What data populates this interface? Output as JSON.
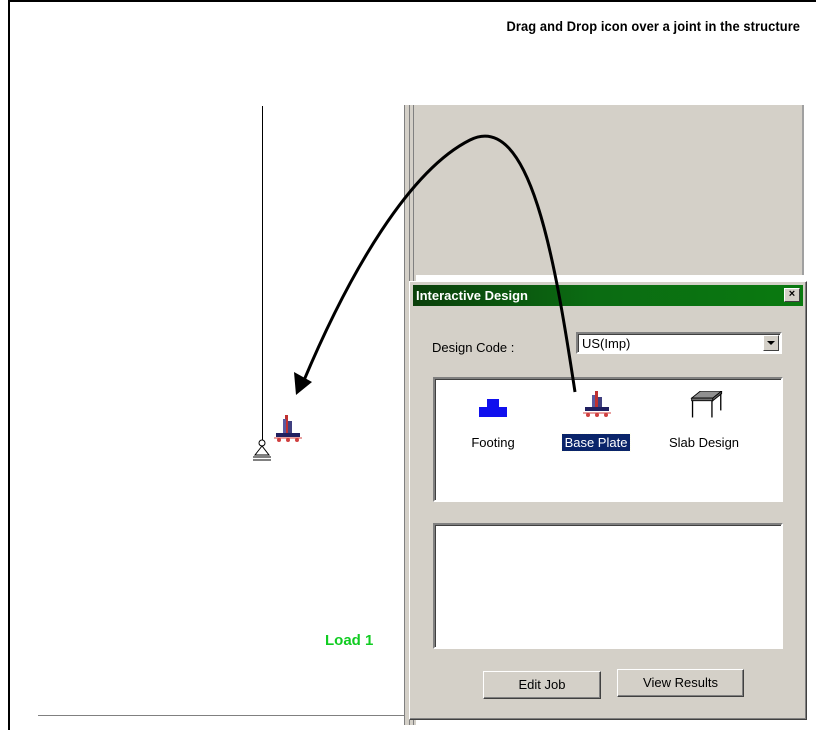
{
  "caption": "Drag and Drop icon over a joint in the structure",
  "viewport": {
    "load_label": "Load 1"
  },
  "dialog": {
    "title": "Interactive Design",
    "close_label": "×",
    "design_code_label": "Design Code :",
    "design_code_value": "US(Imp)",
    "icons": [
      {
        "name": "footing-icon",
        "label": "Footing",
        "selected": false
      },
      {
        "name": "base-plate-icon",
        "label": "Base Plate",
        "selected": true
      },
      {
        "name": "slab-design-icon",
        "label": "Slab Design",
        "selected": false
      }
    ],
    "buttons": {
      "edit_job": "Edit Job",
      "view_results": "View Results"
    }
  },
  "colors": {
    "titlebar": "#0b6b12",
    "load_label": "#11cc22",
    "footing": "#1010ee",
    "selection": "#0a246a"
  }
}
